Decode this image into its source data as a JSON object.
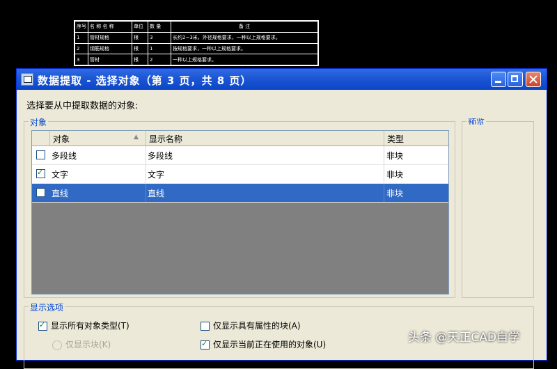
{
  "cad_table": {
    "header": [
      "序号",
      "名 称 名 称",
      "单位",
      "数 量",
      "备 注"
    ],
    "rows": [
      [
        "1",
        "管材规格",
        "根",
        "3",
        "长约2~3米，外径规格要求，一种以上规格要求。"
      ],
      [
        "2",
        "钢筋规格",
        "根",
        "1",
        "按规格要求，一种以上规格要求。"
      ],
      [
        "3",
        "管材",
        "根",
        "2",
        "一种以上规格要求。"
      ]
    ]
  },
  "dialog": {
    "title": "数据提取 - 选择对象（第 3 页，共 8 页）",
    "prompt": "选择要从中提取数据的对象:",
    "objects_group": "对象",
    "preview_group": "预览",
    "columns": [
      "对象",
      "显示名称",
      "类型"
    ],
    "rows": [
      {
        "object": "多段线",
        "display": "多段线",
        "type": "非块",
        "checked": false,
        "selected": false
      },
      {
        "object": "文字",
        "display": "文字",
        "type": "非块",
        "checked": true,
        "selected": false
      },
      {
        "object": "直线",
        "display": "直线",
        "type": "非块",
        "checked": false,
        "selected": true
      }
    ],
    "display_options_group": "显示选项",
    "options": {
      "show_all_types": "显示所有对象类型(T)",
      "show_blocks_only": "仅显示块(K)",
      "show_attr_blocks": "仅显示具有属性的块(A)",
      "show_in_use": "仅显示当前正在使用的对象(U)"
    }
  },
  "watermark": "头条 @天正CAD自学"
}
